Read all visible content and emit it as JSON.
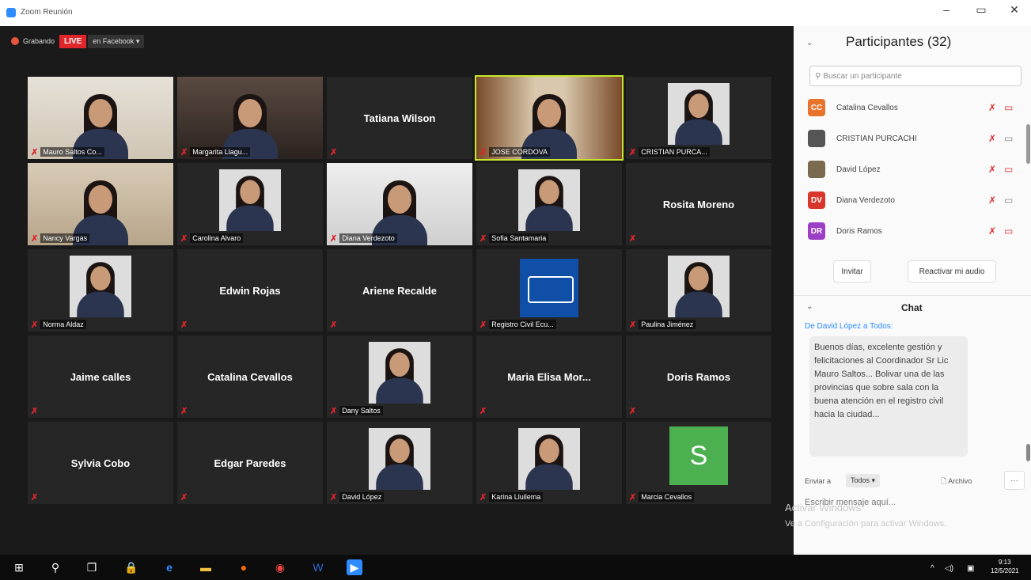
{
  "window": {
    "title": "Zoom Reunión",
    "minimize": "–",
    "maximize": "▭",
    "close": "✕"
  },
  "recording": {
    "label": "Grabando",
    "live_label": "LIVE",
    "platform_label": "en Facebook"
  },
  "tiles": [
    {
      "name": "Mauro Saltos Co...",
      "type": "video",
      "bg": "room"
    },
    {
      "name": "Margarita Llagu...",
      "type": "video",
      "bg": "dark"
    },
    {
      "name": "Tatiana Wilson",
      "type": "name"
    },
    {
      "name": "JOSE CORDOVA",
      "type": "video",
      "bg": "wood",
      "active": true
    },
    {
      "name": "CRISTIAN PURCA...",
      "type": "thumb",
      "bg": "light"
    },
    {
      "name": "Nancy Vargas",
      "type": "video",
      "bg": "beige"
    },
    {
      "name": "Carolina Alvaro",
      "type": "thumb",
      "bg": "beige"
    },
    {
      "name": "Diana Verdezoto",
      "type": "video",
      "bg": "light"
    },
    {
      "name": "Sofia Santamaria",
      "type": "thumb",
      "bg": "beige"
    },
    {
      "name": "Rosita Moreno",
      "type": "name"
    },
    {
      "name": "Norma Aldaz",
      "type": "thumb",
      "bg": "dark"
    },
    {
      "name": "Edwin Rojas",
      "type": "name"
    },
    {
      "name": "Ariene Recalde",
      "type": "name"
    },
    {
      "name": "Registro Civil Ecu...",
      "type": "logo"
    },
    {
      "name": "Paulina Jiménez",
      "type": "thumb",
      "bg": "light"
    },
    {
      "name": "Jaime calles",
      "type": "name"
    },
    {
      "name": "Catalina Cevallos",
      "type": "name"
    },
    {
      "name": "Dany Saltos",
      "type": "thumb",
      "bg": "light"
    },
    {
      "name": "Maria Elisa Mor...",
      "type": "name"
    },
    {
      "name": "Doris Ramos",
      "type": "name"
    },
    {
      "name": "Sylvia Cobo",
      "type": "name"
    },
    {
      "name": "Edgar Paredes",
      "type": "name"
    },
    {
      "name": "David López",
      "type": "thumb",
      "bg": "light"
    },
    {
      "name": "Karina Lluilema",
      "type": "thumb",
      "bg": "light"
    },
    {
      "name": "Marcia Cevallos",
      "type": "avatar",
      "letter": "S"
    }
  ],
  "participants_panel": {
    "title": "Participantes (32)",
    "search_placeholder": "Buscar un participante",
    "items": [
      {
        "initials": "CC",
        "name": "Catalina Cevallos",
        "color": "#e8742c",
        "cam_muted": true
      },
      {
        "initials": "",
        "name": "CRISTIAN PURCACHI",
        "color": "#555555",
        "cam_muted": false
      },
      {
        "initials": "",
        "name": "David López",
        "color": "#7a6a4f",
        "cam_muted": true
      },
      {
        "initials": "DV",
        "name": "Diana Verdezoto",
        "color": "#d9362b",
        "cam_muted": false
      },
      {
        "initials": "DR",
        "name": "Doris Ramos",
        "color": "#9c3fc7",
        "cam_muted": true
      }
    ],
    "invite_label": "Invitar",
    "unmute_label": "Reactivar mi audio"
  },
  "chat": {
    "title": "Chat",
    "from": "De David López a Todos:",
    "message": "Buenos días, excelente gestión y felicitaciones al Coordinador Sr Lic Mauro Saltos... Bolivar una de las provincias que sobre sala con la buena atención en el registro civil hacia la ciudad...",
    "send_to_label": "Enviar a",
    "recipient": "Todos",
    "file_label": "Archivo",
    "input_placeholder": "Escribir mensaje aquí..."
  },
  "watermark": {
    "line1": "Activar Windows",
    "line2": "Ve a Configuración para activar Windows."
  },
  "taskbar": {
    "time": "9:13",
    "date": "12/5/2021"
  }
}
